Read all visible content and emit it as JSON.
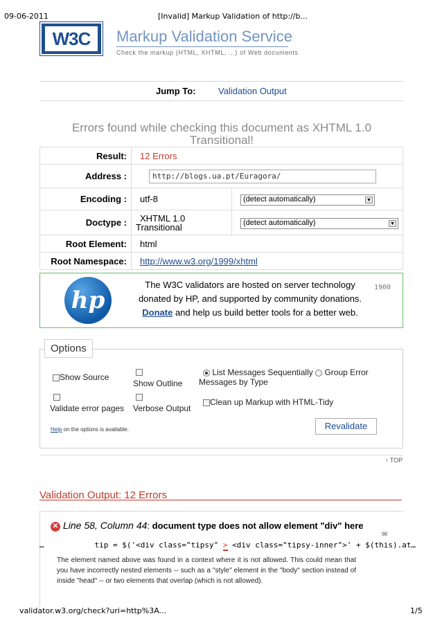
{
  "print_header": {
    "date": "09-06-2011",
    "title": "[Invalid] Markup Validation of http://b..."
  },
  "logo": {
    "text": "W3C"
  },
  "service": {
    "title": "Markup Validation Service",
    "subtitle": "Check the markup (HTML, XHTML, ...) of Web documents"
  },
  "jump": {
    "label": "Jump To:",
    "link": "Validation Output"
  },
  "errors_title": "Errors found while checking this document as XHTML 1.0 Transitional!",
  "results": {
    "result_label": "Result:",
    "result_value": "12 Errors",
    "address_label": "Address :",
    "address_value": "http://blogs.ua.pt/Euragora/",
    "encoding_label": "Encoding :",
    "encoding_value": "utf-8",
    "encoding_select": "(detect automatically)",
    "doctype_label": "Doctype :",
    "doctype_value_1": "XHTML 1.0",
    "doctype_value_2": "Transitional",
    "doctype_select": "(detect automatically)",
    "root_element_label": "Root Element:",
    "root_element_value": "html",
    "root_ns_label": "Root Namespace:",
    "root_ns_value": "http://www.w3.org/1999/xhtml"
  },
  "sponsor": {
    "logo_text": "hp",
    "line1": "The W3C validators are hosted on server technology",
    "line2": "donated by HP, and supported by community donations.",
    "donate": "Donate",
    "line3_rest": " and help us build better tools for a better web.",
    "counter": "1900"
  },
  "options": {
    "legend": "Options",
    "show_source": "Show Source",
    "show_outline": "Show Outline",
    "list_seq": "List Messages Sequentially",
    "group_error": "Group Error",
    "by_type": "Messages by Type",
    "validate_pages": "Validate error pages",
    "verbose": "Verbose Output",
    "tidy": "Clean up Markup with HTML-Tidy",
    "help_link": "Help",
    "help_rest": " on the options is available.",
    "revalidate": "Revalidate"
  },
  "top_link": "↑ TOP",
  "output": {
    "title": "Validation Output: 12 Errors",
    "error1": {
      "location": "Line 58, Column 44",
      "message": "document type does not allow element \"div\" here",
      "code_prefix": "…           tip = $('<div class=\"tipsy\"",
      "code_mark": ">",
      "code_suffix": "<div class=\"tipsy-inner\">' + $(this).at…",
      "desc": "The element named above was found in a context where it is not allowed. This could mean that you have incorrectly nested elements -- such as a \"style\" element in the \"body\" section instead of inside \"head\" -- or two elements that overlap (which is not allowed)."
    }
  },
  "print_footer": {
    "url": "validator.w3.org/check?uri=http%3A...",
    "page": "1/5"
  }
}
